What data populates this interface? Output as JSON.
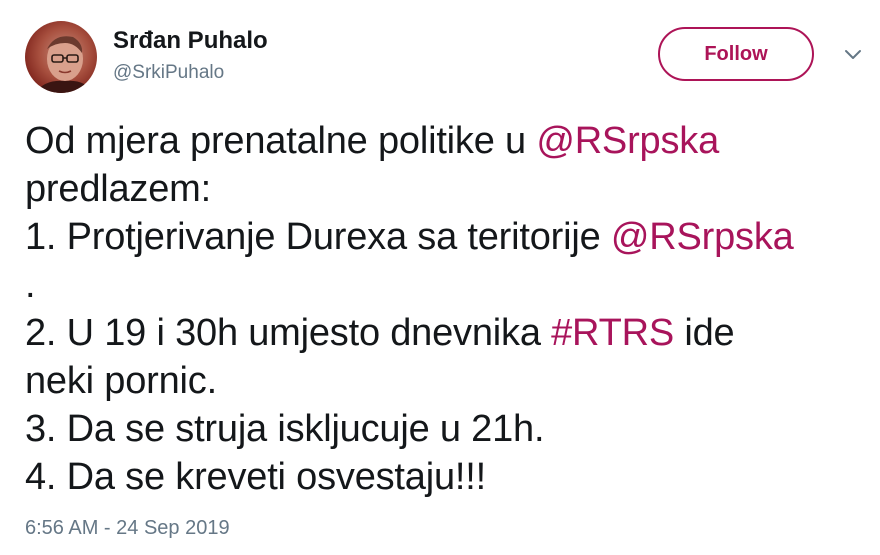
{
  "user": {
    "display_name": "Srđan Puhalo",
    "handle": "@SrkiPuhalo"
  },
  "header": {
    "follow_label": "Follow",
    "menu_icon": "chevron-down-icon"
  },
  "tweet": {
    "lines": [
      {
        "pre": "Od mjera prenatalne politike u ",
        "mention": "@RSrpska"
      },
      {
        "text": "predlazem:"
      },
      {
        "pre": "1. Protjerivanje Durexa sa teritorije ",
        "mention": "@RSrpska"
      },
      {
        "text": "."
      },
      {
        "pre": "2. U 19 i 30h umjesto dnevnika ",
        "hashtag": "#RTRS",
        "post": " ide"
      },
      {
        "text": "neki pornic."
      },
      {
        "text": "3. Da se struja iskljucuje u 21h."
      },
      {
        "text": "4. Da se kreveti osvestaju!!!"
      }
    ],
    "timestamp": "6:56 AM - 24 Sep 2019"
  },
  "colors": {
    "accent": "#ad1457",
    "link": "#a8145b",
    "muted": "#657786",
    "text": "#14171a"
  }
}
